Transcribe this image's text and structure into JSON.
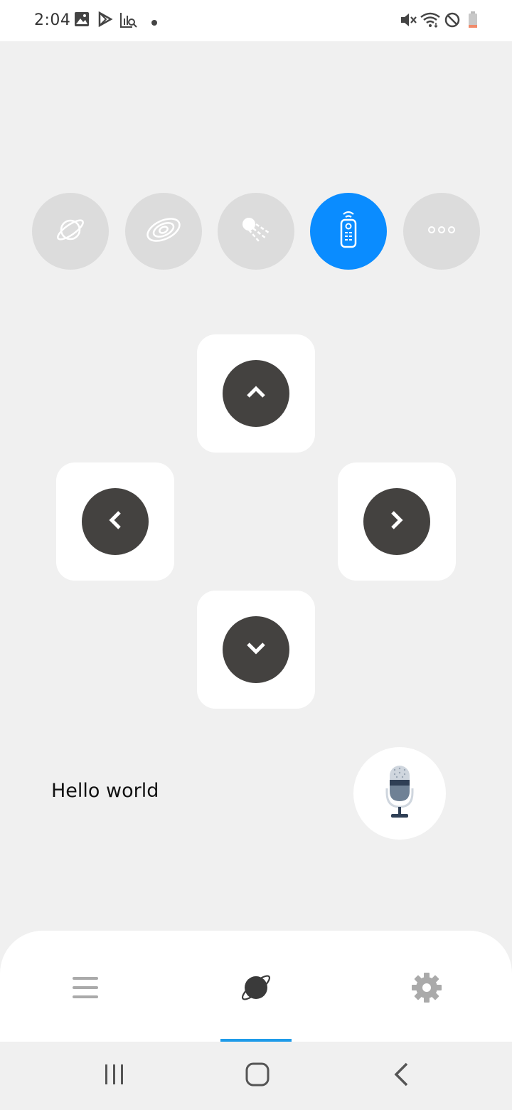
{
  "status_bar": {
    "time": "2:04",
    "left_icons": [
      "image-icon",
      "play-store-icon",
      "analytics-icon",
      "dot-icon"
    ],
    "right_icons": [
      "mute-icon",
      "wifi-icon",
      "do-not-disturb-icon",
      "battery-icon"
    ]
  },
  "modes": [
    {
      "name": "planet-mode",
      "icon": "planet-icon",
      "active": false
    },
    {
      "name": "galaxy-mode",
      "icon": "galaxy-icon",
      "active": false
    },
    {
      "name": "comet-mode",
      "icon": "comet-icon",
      "active": false
    },
    {
      "name": "remote-mode",
      "icon": "remote-icon",
      "active": true
    },
    {
      "name": "more-mode",
      "icon": "more-icon",
      "active": false
    }
  ],
  "dpad": {
    "up": "chevron-up-icon",
    "left": "chevron-left-icon",
    "right": "chevron-right-icon",
    "down": "chevron-down-icon"
  },
  "speech": {
    "text": "Hello world",
    "mic_icon": "microphone-icon"
  },
  "tabs": [
    {
      "name": "menu",
      "icon": "menu-icon",
      "active": false
    },
    {
      "name": "home",
      "icon": "planet-icon",
      "active": true
    },
    {
      "name": "settings",
      "icon": "gear-icon",
      "active": false
    }
  ],
  "colors": {
    "accent": "#0a8cff",
    "tab_indicator": "#1e9be9",
    "pad_circle": "#444240",
    "background": "#f0f0f0"
  }
}
